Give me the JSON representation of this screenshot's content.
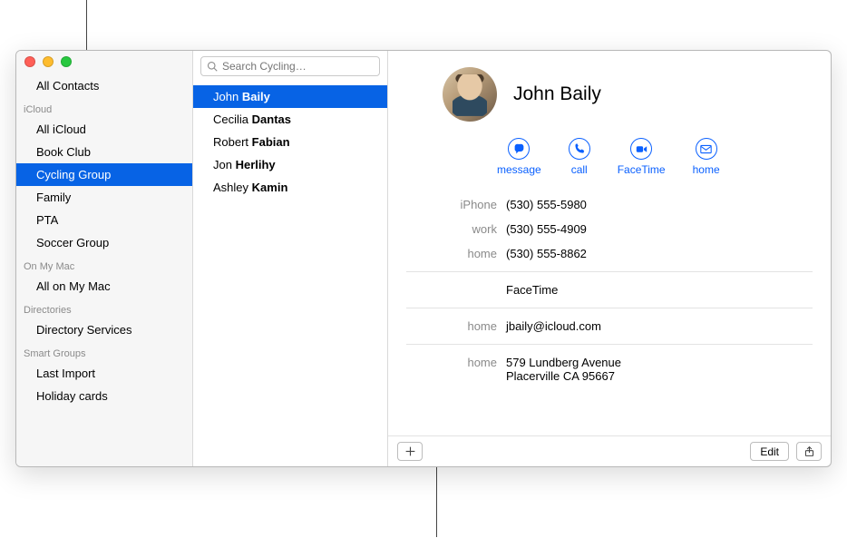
{
  "sidebar": {
    "topItem": "All Contacts",
    "sections": [
      {
        "heading": "iCloud",
        "items": [
          {
            "label": "All iCloud",
            "selected": false
          },
          {
            "label": "Book Club",
            "selected": false
          },
          {
            "label": "Cycling Group",
            "selected": true
          },
          {
            "label": "Family",
            "selected": false
          },
          {
            "label": "PTA",
            "selected": false
          },
          {
            "label": "Soccer Group",
            "selected": false
          }
        ]
      },
      {
        "heading": "On My Mac",
        "items": [
          {
            "label": "All on My Mac",
            "selected": false
          }
        ]
      },
      {
        "heading": "Directories",
        "items": [
          {
            "label": "Directory Services",
            "selected": false
          }
        ]
      },
      {
        "heading": "Smart Groups",
        "items": [
          {
            "label": "Last Import",
            "selected": false
          },
          {
            "label": "Holiday cards",
            "selected": false
          }
        ]
      }
    ]
  },
  "search": {
    "placeholder": "Search Cycling…"
  },
  "contactsList": [
    {
      "first": "John",
      "last": "Baily",
      "selected": true
    },
    {
      "first": "Cecilia",
      "last": "Dantas",
      "selected": false
    },
    {
      "first": "Robert",
      "last": "Fabian",
      "selected": false
    },
    {
      "first": "Jon",
      "last": "Herlihy",
      "selected": false
    },
    {
      "first": "Ashley",
      "last": "Kamin",
      "selected": false
    }
  ],
  "detail": {
    "name": "John Baily",
    "actions": [
      {
        "icon": "message-icon",
        "label": "message"
      },
      {
        "icon": "call-icon",
        "label": "call"
      },
      {
        "icon": "facetime-icon",
        "label": "FaceTime"
      },
      {
        "icon": "mail-icon",
        "label": "home"
      }
    ],
    "phones": [
      {
        "label": "iPhone",
        "value": "(530) 555-5980"
      },
      {
        "label": "work",
        "value": "(530) 555-4909"
      },
      {
        "label": "home",
        "value": "(530) 555-8862"
      }
    ],
    "facetime": {
      "label": "",
      "value": "FaceTime"
    },
    "email": {
      "label": "home",
      "value": "jbaily@icloud.com"
    },
    "address": {
      "label": "home",
      "line1": "579 Lundberg Avenue",
      "line2": "Placerville CA 95667"
    }
  },
  "footer": {
    "editLabel": "Edit"
  }
}
